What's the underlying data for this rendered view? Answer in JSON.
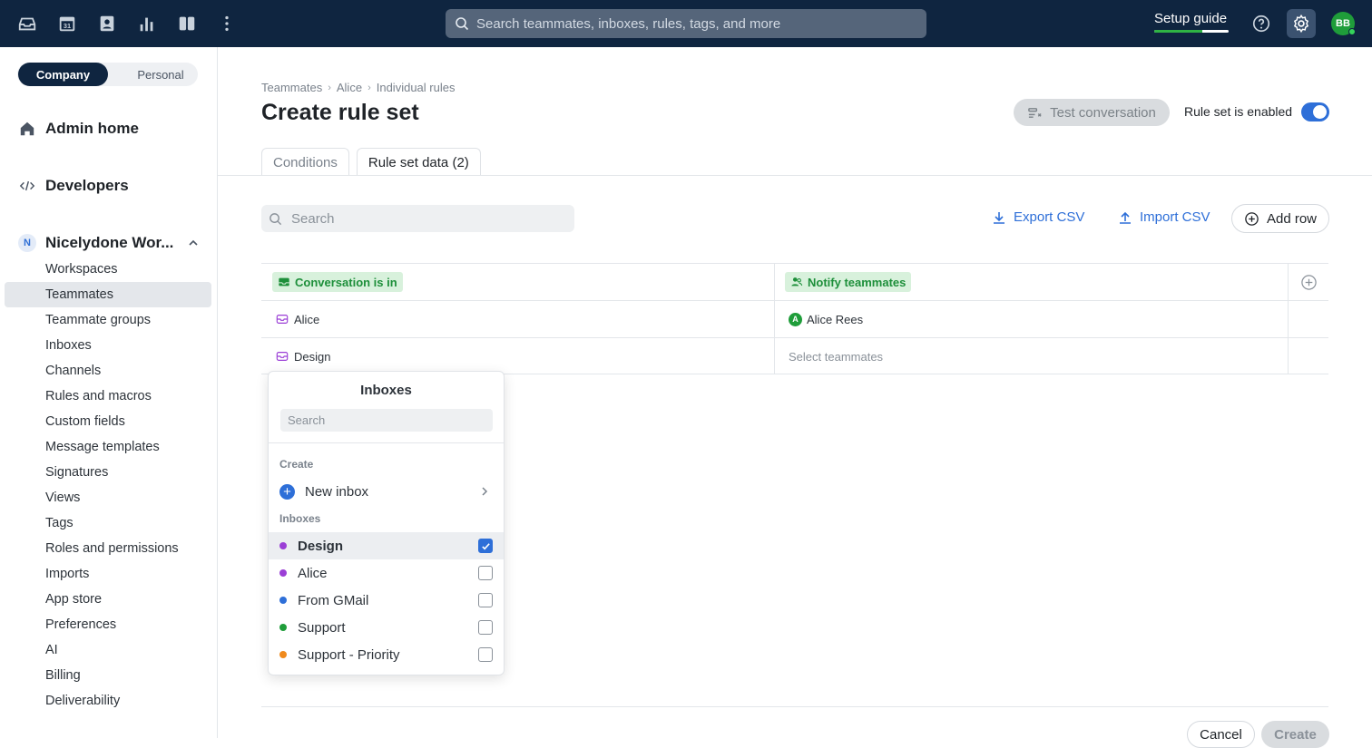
{
  "topbar": {
    "search_placeholder": "Search teammates, inboxes, rules, tags, and more",
    "setup_guide": "Setup guide",
    "setup_progress": 0.65,
    "avatar_initials": "BB",
    "icons": [
      "inbox-icon",
      "calendar-icon",
      "contacts-icon",
      "analytics-icon",
      "split-view-icon",
      "more-icon"
    ],
    "calendar_day": "31"
  },
  "sidebar": {
    "segments": {
      "company": "Company",
      "personal": "Personal"
    },
    "admin_home": "Admin home",
    "developers": "Developers",
    "workspace": {
      "badge": "N",
      "name": "Nicelydone Wor..."
    },
    "items": [
      {
        "label": "Workspaces"
      },
      {
        "label": "Teammates"
      },
      {
        "label": "Teammate groups"
      },
      {
        "label": "Inboxes"
      },
      {
        "label": "Channels"
      },
      {
        "label": "Rules and macros"
      },
      {
        "label": "Custom fields"
      },
      {
        "label": "Message templates"
      },
      {
        "label": "Signatures"
      },
      {
        "label": "Views"
      },
      {
        "label": "Tags"
      },
      {
        "label": "Roles and permissions"
      },
      {
        "label": "Imports"
      },
      {
        "label": "App store"
      },
      {
        "label": "Preferences"
      },
      {
        "label": "AI"
      },
      {
        "label": "Billing"
      },
      {
        "label": "Deliverability"
      }
    ]
  },
  "main": {
    "breadcrumb": [
      "Teammates",
      "Alice",
      "Individual rules"
    ],
    "title": "Create rule set",
    "test_conversation": "Test conversation",
    "enabled_label": "Rule set is enabled",
    "tabs": [
      {
        "label": "Conditions"
      },
      {
        "label": "Rule set data (2)"
      }
    ],
    "search_placeholder": "Search",
    "export_csv": "Export CSV",
    "import_csv": "Import CSV",
    "add_row": "Add row",
    "table": {
      "col1": "Conversation is in",
      "col2": "Notify teammates",
      "rows": [
        {
          "inbox": "Alice",
          "teammate": "Alice Rees",
          "teammate_initial": "A"
        },
        {
          "inbox": "Design",
          "teammate_placeholder": "Select teammates"
        }
      ]
    },
    "cancel": "Cancel",
    "create": "Create"
  },
  "dropdown": {
    "title": "Inboxes",
    "search_placeholder": "Search",
    "create_section": "Create",
    "new_inbox": "New inbox",
    "inboxes_section": "Inboxes",
    "items": [
      {
        "label": "Design",
        "color": "#9b3fd6",
        "checked": true
      },
      {
        "label": "Alice",
        "color": "#9b3fd6",
        "checked": false
      },
      {
        "label": "From GMail",
        "color": "#2e6fd8",
        "checked": false
      },
      {
        "label": "Support",
        "color": "#1f9d3a",
        "checked": false
      },
      {
        "label": "Support - Priority",
        "color": "#f08a1c",
        "checked": false
      }
    ]
  }
}
